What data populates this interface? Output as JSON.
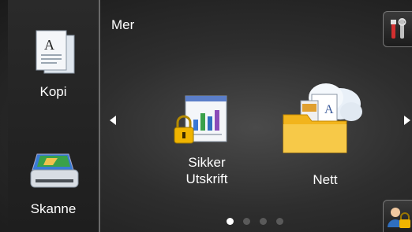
{
  "sidebar": {
    "items": [
      {
        "label": "Kopi",
        "icon": "copy-document-icon"
      },
      {
        "label": "Skanne",
        "icon": "scanner-icon"
      }
    ]
  },
  "main": {
    "title": "Mer",
    "apps": [
      {
        "label_line1": "Sikker",
        "label_line2": "Utskrift",
        "icon": "secure-print-icon"
      },
      {
        "label": "Nett",
        "icon": "web-cloud-folder-icon"
      }
    ],
    "pagination": {
      "pages": 4,
      "current": 1
    }
  },
  "toolbar": {
    "settings_icon": "tools-icon",
    "lock_icon": "user-lock-icon"
  },
  "colors": {
    "background": "#2e2e2e",
    "text": "#ffffff",
    "lock": "#f0b400"
  }
}
